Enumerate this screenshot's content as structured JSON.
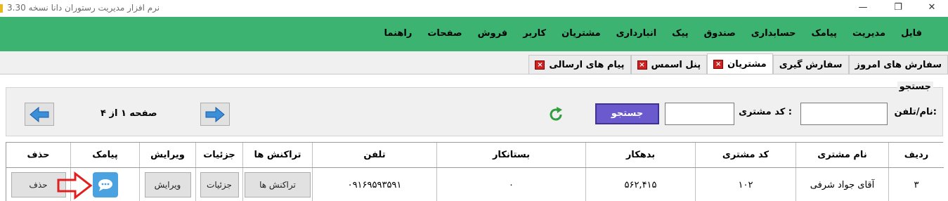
{
  "window": {
    "title": "نرم افزار مدیریت رستوران دانا  نسخه   3.30",
    "minimize": "—",
    "maximize": "❐",
    "close": "✕"
  },
  "menu": [
    "فایل",
    "مدیریت",
    "پیامک",
    "حسابداری",
    "صندوق",
    "پیک",
    "انبارداری",
    "مشتریان",
    "کاربر",
    "فروش",
    "صفحات",
    "راهنما"
  ],
  "tabs": [
    {
      "label": "سفارش های امروز",
      "closable": false,
      "active": false
    },
    {
      "label": "سفارش گیری",
      "closable": false,
      "active": false
    },
    {
      "label": "مشتریان",
      "closable": true,
      "active": true
    },
    {
      "label": "پنل اسمس",
      "closable": true,
      "active": false
    },
    {
      "label": "پیام های ارسالی",
      "closable": true,
      "active": false
    }
  ],
  "search": {
    "group_title": "جستجو",
    "name_phone_label": "نام/تلفن:",
    "customer_code_label": "کد مشتری :",
    "search_button": "جستجو",
    "name_phone_value": "",
    "customer_code_value": ""
  },
  "pager": {
    "text": "صفحه ۱ از ۴"
  },
  "grid": {
    "headers": {
      "row": "ردیف",
      "name": "نام مشتری",
      "code": "کد مشتری",
      "debtor": "بدهکار",
      "creditor": "بستانکار",
      "phone": "تلفن",
      "transactions": "تراکنش ها",
      "details": "جزئیات",
      "edit": "ویرایش",
      "sms": "پیامک",
      "delete": "حذف"
    },
    "rows": [
      {
        "row": "۳",
        "name": "آقای جواد شرفی",
        "code": "۱۰۲",
        "debtor": "۵۶۲,۴۱۵",
        "creditor": "۰",
        "phone": "۰۹۱۶۹۵۹۳۵۹۱",
        "transactions_btn": "تراکنش ها",
        "details_btn": "جزئیات",
        "edit_btn": "ویرایش",
        "delete_btn": "حذف"
      }
    ]
  },
  "colors": {
    "menubar": "#3cb371",
    "search_button": "#6a5acd",
    "tab_close": "#cc2222",
    "annotation_arrow": "#e02020",
    "sms_icon": "#4aa3e0",
    "refresh_icon": "#2e9e3e",
    "nav_arrow": "#3a8fd8"
  },
  "icons": {
    "tab_close": "close-x-icon",
    "refresh": "refresh-icon",
    "next": "arrow-right-icon",
    "prev": "arrow-left-icon",
    "sms": "chat-bubble-icon",
    "annotation": "red-arrow-annotation"
  }
}
